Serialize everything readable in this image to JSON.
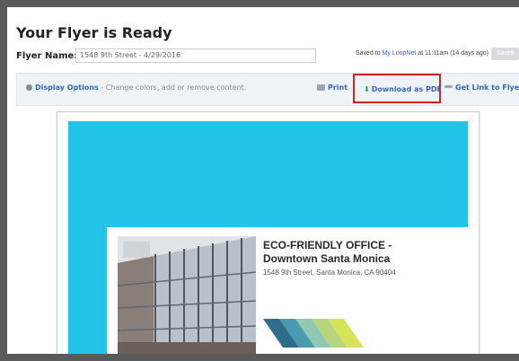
{
  "header": {
    "title": "Your Flyer is Ready"
  },
  "flyer_name": {
    "label": "Flyer Name:",
    "value": "1548 9th Street - 4/29/2016"
  },
  "saved": {
    "prefix": "Saved to ",
    "link": "My LoopNet",
    "suffix": " at 11:11am (14 days ago)"
  },
  "save_button": {
    "label": "Saved"
  },
  "toolbar": {
    "display_options": "Display Options",
    "display_options_sub": " - Change colors, add or remove content.",
    "print": "Print",
    "download_pdf": "Download as PDF",
    "get_link": "Get Link to Flyer"
  },
  "flyer": {
    "title_line1": "ECO-FRIENDLY OFFICE -",
    "title_line2": "Downtown Santa Monica",
    "address": "1548 9th Street, Santa Monica, CA 90404"
  },
  "colors": {
    "accent_cyan": "#23c4ea",
    "link_blue": "#3866b8",
    "highlight_red": "#e02020",
    "download_green": "#2fa13b"
  },
  "icons": [
    "gear-icon",
    "printer-icon",
    "download-arrow-icon",
    "link-icon"
  ]
}
